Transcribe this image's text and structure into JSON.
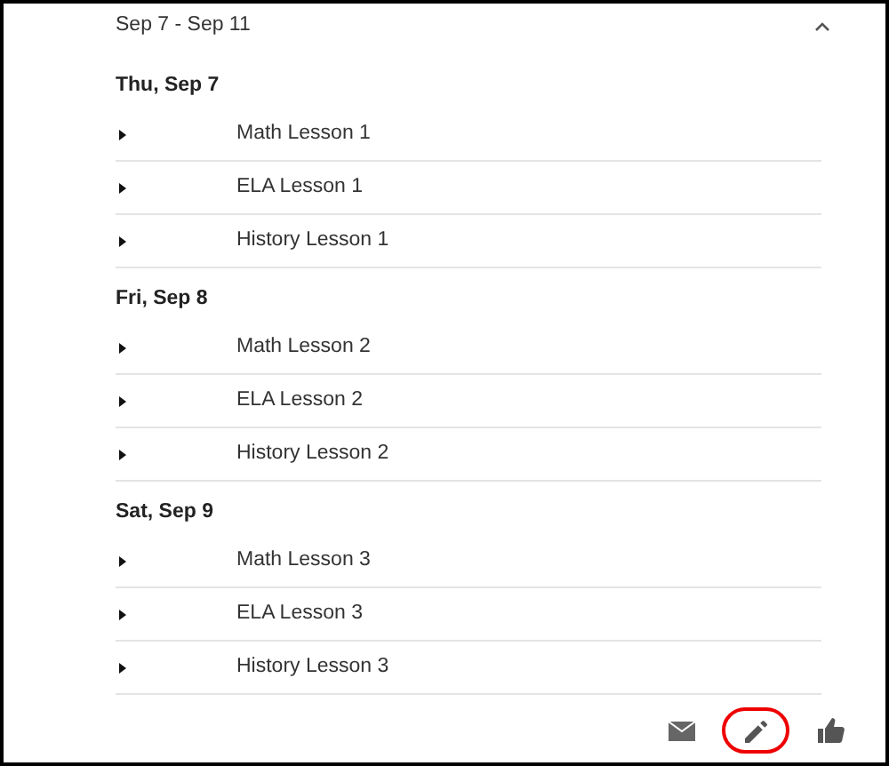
{
  "week": {
    "title": "Sep 7 - Sep 11",
    "expanded": true
  },
  "days": [
    {
      "title": "Thu, Sep 7",
      "lessons": [
        {
          "title": "Math Lesson 1",
          "expanded": false
        },
        {
          "title": "ELA Lesson 1",
          "expanded": false
        },
        {
          "title": "History Lesson 1",
          "expanded": false
        }
      ]
    },
    {
      "title": "Fri, Sep 8",
      "lessons": [
        {
          "title": "Math Lesson 2",
          "expanded": false
        },
        {
          "title": "ELA Lesson 2",
          "expanded": false
        },
        {
          "title": "History Lesson 2",
          "expanded": false
        }
      ]
    },
    {
      "title": "Sat, Sep 9",
      "lessons": [
        {
          "title": "Math Lesson 3",
          "expanded": false
        },
        {
          "title": "ELA Lesson 3",
          "expanded": false
        },
        {
          "title": "History Lesson 3",
          "expanded": false
        }
      ]
    }
  ],
  "actions": [
    {
      "kind": "mail",
      "circled": false
    },
    {
      "kind": "edit",
      "circled": true
    },
    {
      "kind": "like",
      "circled": false
    }
  ]
}
